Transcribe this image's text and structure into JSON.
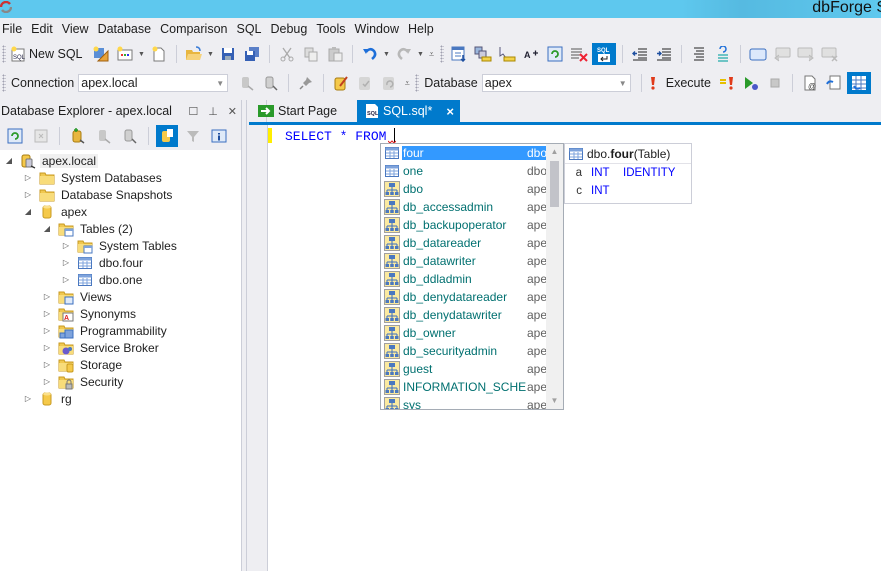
{
  "window": {
    "title": "dbForge S"
  },
  "menu": [
    "File",
    "Edit",
    "View",
    "Database",
    "Comparison",
    "SQL",
    "Debug",
    "Tools",
    "Window",
    "Help"
  ],
  "toolbar1": {
    "new_sql_label": "New SQL",
    "buttons": [
      "new-sql",
      "query-builder",
      "new-object",
      "new-file",
      "open",
      "save",
      "save-all",
      "cut",
      "copy",
      "paste",
      "undo",
      "redo",
      "toolbar-options",
      "retrieve-data",
      "compare-schema",
      "compare-data",
      "format-text",
      "refresh",
      "clear",
      "sql-mode",
      "decrease-indent",
      "increase-indent",
      "comment",
      "uncomment",
      "window",
      "prev",
      "next",
      "close-window"
    ]
  },
  "toolbar2": {
    "connection_label": "Connection",
    "connection_value": "apex.local",
    "database_label": "Database",
    "database_value": "apex",
    "execute_label": "Execute"
  },
  "explorer": {
    "title": "Database Explorer - apex.local",
    "tree": [
      {
        "label": "apex.local",
        "level": 0,
        "expanded": true,
        "icon": "server-icon",
        "selected": true
      },
      {
        "label": "System Databases",
        "level": 1,
        "expanded": false,
        "icon": "folder-icon"
      },
      {
        "label": "Database Snapshots",
        "level": 1,
        "expanded": false,
        "icon": "folder-icon"
      },
      {
        "label": "apex",
        "level": 1,
        "expanded": true,
        "icon": "database-icon"
      },
      {
        "label": "Tables (2)",
        "level": 2,
        "expanded": true,
        "icon": "tables-folder-icon"
      },
      {
        "label": "System Tables",
        "level": 3,
        "expanded": false,
        "icon": "tables-folder-icon"
      },
      {
        "label": "dbo.four",
        "level": 3,
        "expanded": false,
        "icon": "table-icon"
      },
      {
        "label": "dbo.one",
        "level": 3,
        "expanded": false,
        "icon": "table-icon"
      },
      {
        "label": "Views",
        "level": 2,
        "expanded": false,
        "icon": "views-folder-icon"
      },
      {
        "label": "Synonyms",
        "level": 2,
        "expanded": false,
        "icon": "synonyms-folder-icon"
      },
      {
        "label": "Programmability",
        "level": 2,
        "expanded": false,
        "icon": "programmability-folder-icon"
      },
      {
        "label": "Service Broker",
        "level": 2,
        "expanded": false,
        "icon": "service-broker-folder-icon"
      },
      {
        "label": "Storage",
        "level": 2,
        "expanded": false,
        "icon": "storage-folder-icon"
      },
      {
        "label": "Security",
        "level": 2,
        "expanded": false,
        "icon": "security-folder-icon"
      },
      {
        "label": "rg",
        "level": 1,
        "expanded": false,
        "icon": "database-icon"
      }
    ]
  },
  "tabs": [
    {
      "label": "Start Page",
      "active": false
    },
    {
      "label": "SQL.sql*",
      "active": true,
      "close": "×"
    }
  ],
  "editor": {
    "code": "SELECT * FROM "
  },
  "completion": {
    "items": [
      {
        "name": "four",
        "schema": "dbo",
        "kind": "table",
        "selected": true
      },
      {
        "name": "one",
        "schema": "dbo",
        "kind": "table"
      },
      {
        "name": "dbo",
        "schema": "ape",
        "kind": "schema"
      },
      {
        "name": "db_accessadmin",
        "schema": "ape",
        "kind": "schema"
      },
      {
        "name": "db_backupoperator",
        "schema": "ape",
        "kind": "schema"
      },
      {
        "name": "db_datareader",
        "schema": "ape",
        "kind": "schema"
      },
      {
        "name": "db_datawriter",
        "schema": "ape",
        "kind": "schema"
      },
      {
        "name": "db_ddladmin",
        "schema": "ape",
        "kind": "schema"
      },
      {
        "name": "db_denydatareader",
        "schema": "ape",
        "kind": "schema"
      },
      {
        "name": "db_denydatawriter",
        "schema": "ape",
        "kind": "schema"
      },
      {
        "name": "db_owner",
        "schema": "ape",
        "kind": "schema"
      },
      {
        "name": "db_securityadmin",
        "schema": "ape",
        "kind": "schema"
      },
      {
        "name": "guest",
        "schema": "ape",
        "kind": "schema"
      },
      {
        "name": "INFORMATION_SCHEMA",
        "schema": "ape",
        "kind": "schema"
      },
      {
        "name": "sys",
        "schema": "ape",
        "kind": "schema"
      }
    ]
  },
  "info": {
    "prefix": "dbo.",
    "name": "four",
    "suffix": " (Table)",
    "columns": [
      {
        "name": "a",
        "type": "INT",
        "attr": "IDENTITY"
      },
      {
        "name": "c",
        "type": "INT",
        "attr": ""
      }
    ]
  },
  "colors": {
    "accent": "#007acc",
    "titlebar": "#5ec8ee",
    "selection": "#3399ff",
    "keyword": "#0000ff",
    "completion_text": "#007070"
  }
}
